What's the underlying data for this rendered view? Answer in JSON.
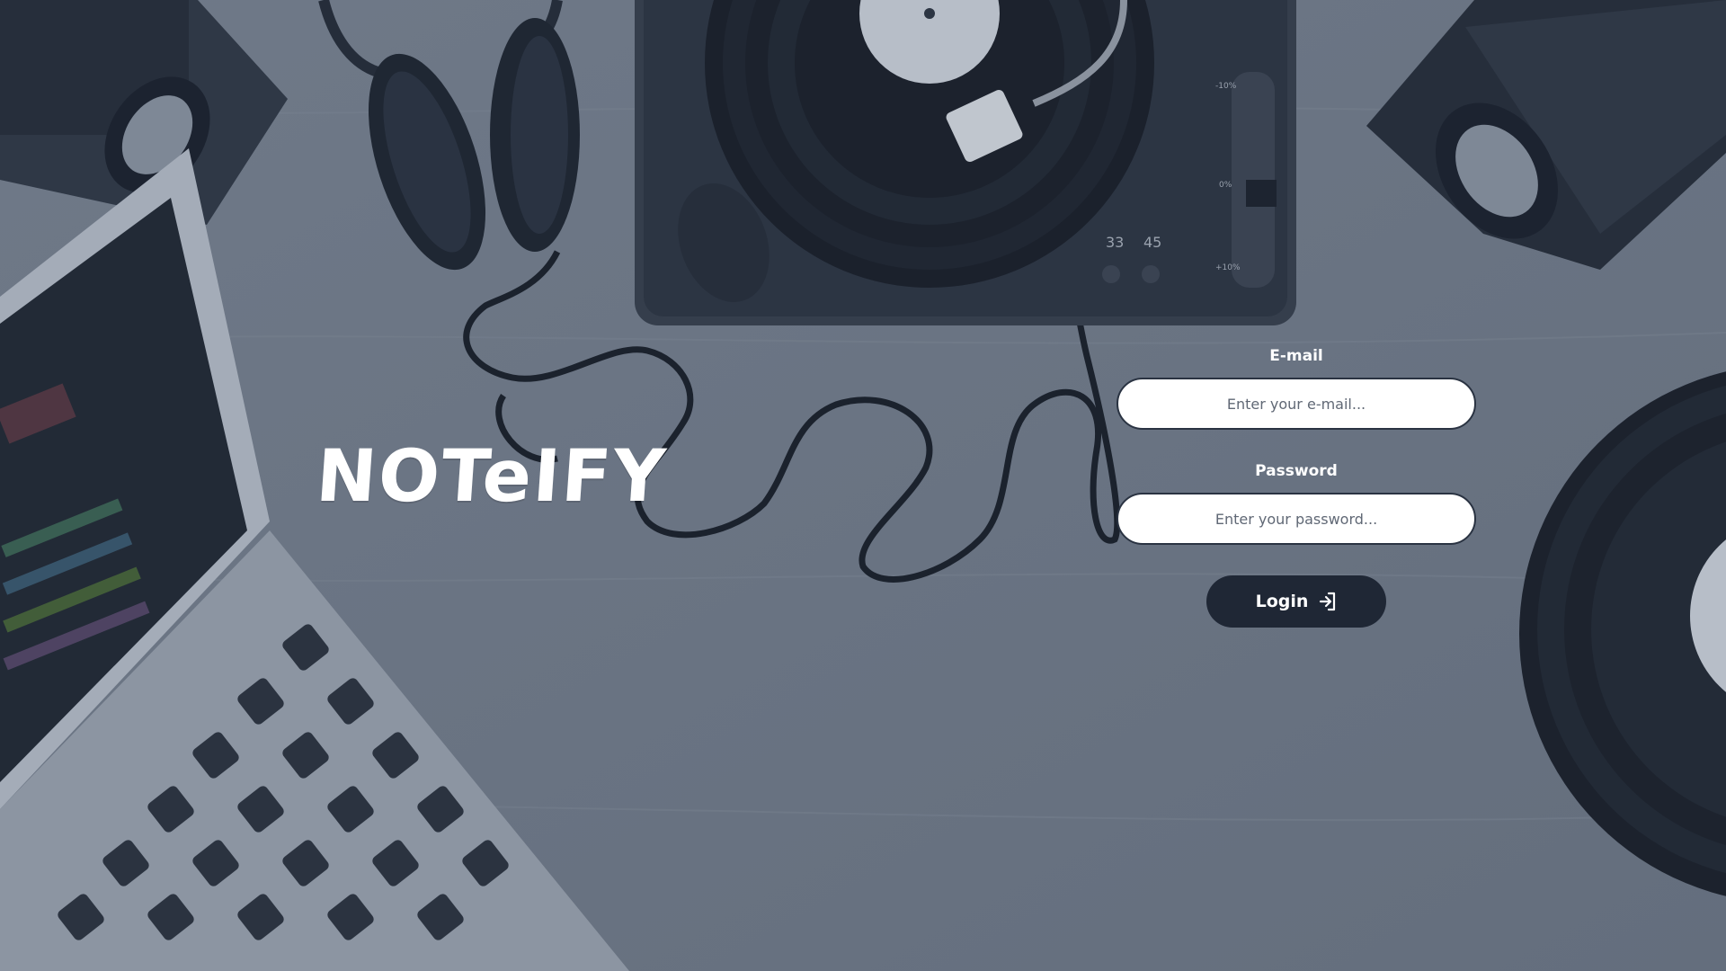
{
  "app": {
    "brand": "NOTeIFY"
  },
  "form": {
    "email_label": "E-mail",
    "email_placeholder": "Enter your e-mail...",
    "email_value": "",
    "password_label": "Password",
    "password_placeholder": "Enter your password...",
    "password_value": "",
    "login_label": "Login",
    "login_icon": "login-arrow-icon"
  },
  "background": {
    "turntable_speeds": [
      "33",
      "45"
    ],
    "pitch_marks": [
      "-10%",
      "0%",
      "+10%"
    ]
  },
  "colors": {
    "overlay": "#6b7584",
    "button": "#1f2735",
    "input_bg": "#ffffff",
    "text_light": "#ffffff"
  }
}
